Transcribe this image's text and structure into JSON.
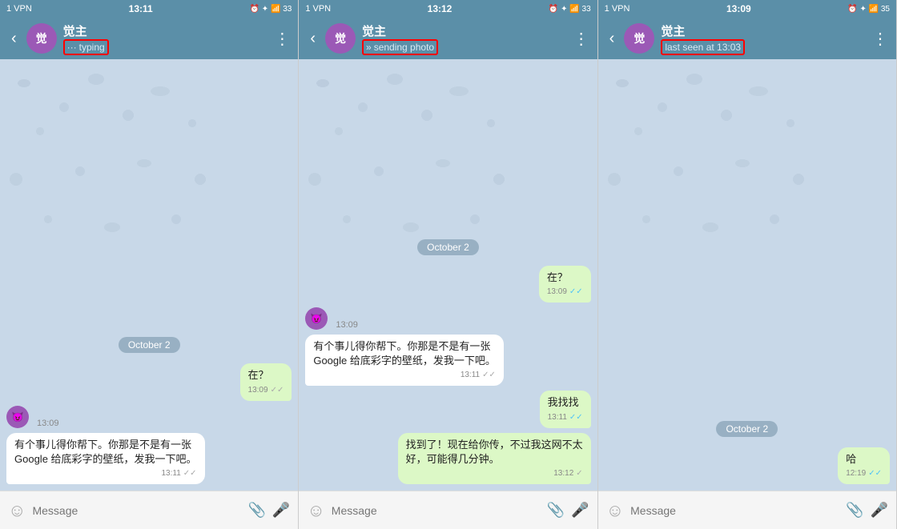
{
  "panels": [
    {
      "id": "panel1",
      "statusBar": {
        "left": "1 VPN",
        "time": "13:11",
        "right": "🕐 ☆ 📶 .il 33"
      },
      "header": {
        "contactName": "觉主",
        "avatarText": "觉",
        "status": {
          "icon": "···",
          "text": "typing",
          "highlighted": true
        }
      },
      "dateLabel": "October 2",
      "messages": [
        {
          "type": "outgoing",
          "text": "在？",
          "time": "13:09",
          "check": "double-grey"
        },
        {
          "type": "incoming",
          "sticker": "😈",
          "time": "13:09"
        },
        {
          "type": "incoming",
          "text": "有个事儿得你帮下。你那是不是有一张\nGoogle 给底彩字的壁纸，发我一下吧。",
          "time": "13:11",
          "check": "double-grey"
        }
      ],
      "inputPlaceholder": "Message"
    },
    {
      "id": "panel2",
      "statusBar": {
        "left": "1 VPN",
        "time": "13:12",
        "right": "🕐 ☆ 📶 .il 33"
      },
      "header": {
        "contactName": "觉主",
        "avatarText": "觉",
        "status": {
          "icon": "»",
          "text": "sending photo",
          "highlighted": true
        }
      },
      "dateLabel": "October 2",
      "messages": [
        {
          "type": "outgoing",
          "text": "在？",
          "time": "13:09",
          "check": "double-blue"
        },
        {
          "type": "incoming",
          "sticker": "😈",
          "time": "13:09"
        },
        {
          "type": "incoming",
          "text": "有个事儿得你帮下。你那是不是有一张\nGoogle 给底彩字的壁纸，发我一下吧。",
          "time": "13:11",
          "check": "double-grey"
        },
        {
          "type": "outgoing",
          "text": "我找找",
          "time": "13:11",
          "check": "double-blue"
        },
        {
          "type": "outgoing",
          "text": "找到了！现在给你传，不过我这网不太\n好，可能得几分钟。",
          "time": "13:12",
          "check": "single-grey"
        }
      ],
      "inputPlaceholder": "Message"
    },
    {
      "id": "panel3",
      "statusBar": {
        "left": "1 VPN",
        "time": "13:09",
        "right": "🕐 ☆ 📶 .il 35"
      },
      "header": {
        "contactName": "觉主",
        "avatarText": "觉",
        "status": {
          "icon": "",
          "text": "last seen at 13:03",
          "highlighted": true
        }
      },
      "dateLabel": "October 2",
      "messages": [
        {
          "type": "outgoing",
          "text": "哈",
          "time": "12:19",
          "check": "double-blue"
        }
      ],
      "inputPlaceholder": "Message"
    }
  ]
}
